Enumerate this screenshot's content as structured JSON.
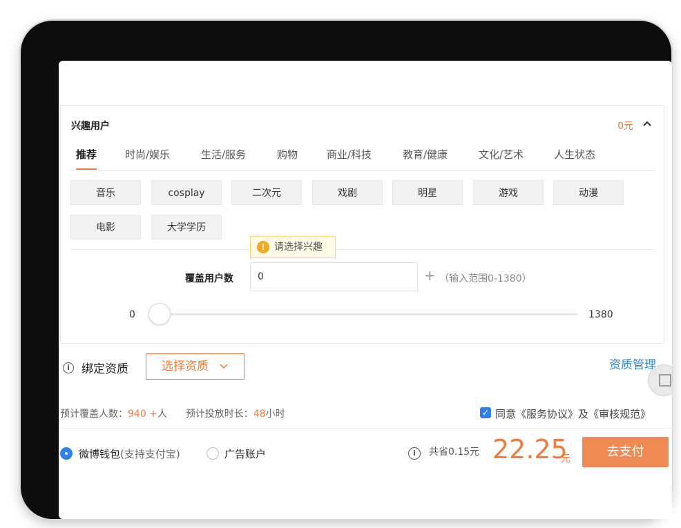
{
  "interest": {
    "title": "兴趣用户",
    "price": "0元",
    "tabs": [
      "推荐",
      "时尚/娱乐",
      "生活/服务",
      "购物",
      "商业/科技",
      "教育/健康",
      "文化/艺术",
      "人生状态"
    ],
    "chips": [
      "音乐",
      "cosplay",
      "二次元",
      "戏剧",
      "明星",
      "游戏",
      "动漫",
      "电影",
      "大学学历"
    ],
    "tooltip": "请选择兴趣",
    "cover_label": "覆盖用户数",
    "cover_value": "0",
    "range_hint": "（输入范围0-1380）",
    "slider": {
      "min": "0",
      "max": "1380",
      "value": 0
    }
  },
  "qualification": {
    "label": "绑定资质",
    "select_label": "选择资质",
    "manage_link": "资质管理"
  },
  "stats": {
    "reach_label": "预计覆盖人数：",
    "reach_value": "940 +",
    "reach_unit": "人",
    "duration_label": "预计投放时长：",
    "duration_value": "48",
    "duration_unit": "小时"
  },
  "agreement": {
    "checked": true,
    "text": "同意《服务协议》及《审核规范》"
  },
  "payment": {
    "wallet_label": "微博钱包",
    "wallet_sub": "(支持支付宝)",
    "ad_account_label": "广告账户",
    "save_text": "共省0.15元",
    "total": "22.25",
    "currency": "元",
    "pay_button": "去支付"
  },
  "colors": {
    "accent": "#f07b3f",
    "link": "#2f86d6",
    "radio": "#2f80ed"
  }
}
